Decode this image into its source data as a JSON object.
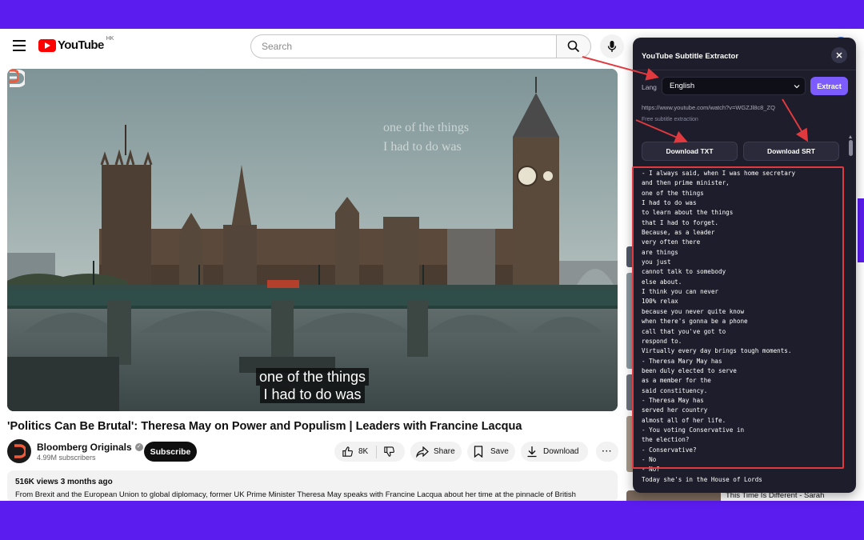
{
  "header": {
    "logo_text": "YouTube",
    "region": "HK",
    "search_placeholder": "Search"
  },
  "video": {
    "caption_faint": [
      "one of the things",
      "I had to do was"
    ],
    "caption": [
      "one of the things",
      "I had to do was"
    ],
    "title": "'Politics Can Be Brutal': Theresa May on Power and Populism | Leaders with Francine Lacqua"
  },
  "channel": {
    "name": "Bloomberg Originals",
    "subscribers": "4.99M subscribers",
    "subscribe_label": "Subscribe"
  },
  "actions": {
    "likes": "8K",
    "share": "Share",
    "save": "Save",
    "download": "Download",
    "more": "···"
  },
  "description": {
    "meta": "516K views  3 months ago",
    "text": "From Brexit and the European Union to global diplomacy, former UK Prime Minister Theresa May speaks with Francine Lacqua about her time at the pinnacle of British"
  },
  "sidebar": {
    "recommended_title": "This Time Is Different - Sarah"
  },
  "extractor": {
    "title": "YouTube Subtitle Extractor",
    "lang_label": "Lang",
    "language": "English",
    "extract_label": "Extract",
    "url": "https://www.youtube.com/watch?v=WGZJl8c8_ZQ",
    "note": "Free subtitle extraction",
    "download_txt": "Download TXT",
    "download_srt": "Download SRT",
    "transcript": [
      "- I always said, when I was home secretary",
      "and then prime minister,",
      "one of the things",
      "I had to do was",
      "to learn about the things",
      "that I had to forget.",
      "Because, as a leader",
      "very often there",
      "are things",
      "you just",
      "cannot talk to somebody",
      "else about.",
      "I think you can never",
      "100% relax",
      "because you never quite know",
      "when there's gonna be a phone",
      "call that you've got to",
      "respond to.",
      "Virtually every day brings tough moments.",
      "- Theresa Mary May has",
      "been duly elected to serve",
      "as a member for the",
      "said constituency.",
      "- Theresa May has",
      "served her country",
      "almost all of her life.",
      "- You voting Conservative in",
      "the election?",
      "- Conservative?",
      "- No",
      "- No?",
      "Today she's in the House of Lords"
    ]
  },
  "colors": {
    "frame_purple": "#5b1cf0",
    "panel_bg": "#1d1d2b",
    "extract_accent": "#7c5cff",
    "annotation_red": "#e0393e",
    "youtube_red": "#ff0000"
  }
}
